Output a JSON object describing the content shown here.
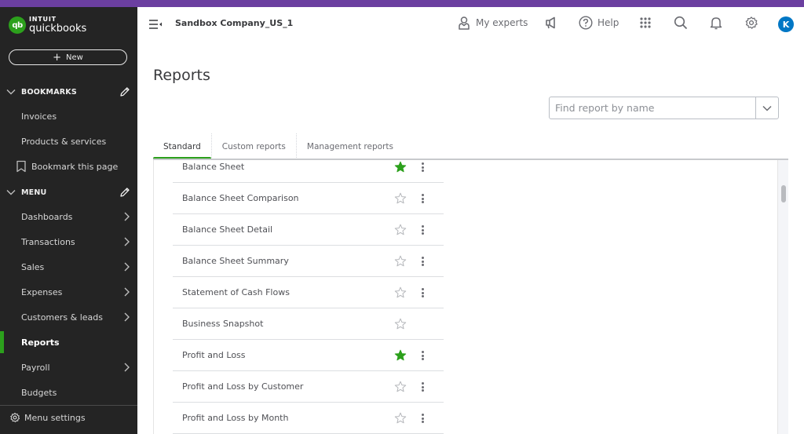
{
  "brand": {
    "badge": "qb",
    "intuit": "INTUIT",
    "product": "quickbooks",
    "accent_top": "#6b3fa0",
    "accent_green": "#2ca01c"
  },
  "sidebar": {
    "new_label": "New",
    "bookmarks_heading": "BOOKMARKS",
    "bookmarks": [
      {
        "label": "Invoices"
      },
      {
        "label": "Products & services"
      }
    ],
    "bookmark_page_label": "Bookmark this page",
    "menu_heading": "MENU",
    "menu": [
      {
        "label": "Dashboards",
        "has_submenu": true
      },
      {
        "label": "Transactions",
        "has_submenu": true
      },
      {
        "label": "Sales",
        "has_submenu": true
      },
      {
        "label": "Expenses",
        "has_submenu": true
      },
      {
        "label": "Customers & leads",
        "has_submenu": true
      },
      {
        "label": "Reports",
        "has_submenu": false,
        "active": true
      },
      {
        "label": "Payroll",
        "has_submenu": true
      },
      {
        "label": "Budgets",
        "has_submenu": false
      }
    ],
    "menu_settings_label": "Menu settings"
  },
  "header": {
    "company_name": "Sandbox Company_US_1",
    "my_experts_label": "My experts",
    "help_label": "Help",
    "avatar_initial": "K"
  },
  "main": {
    "title": "Reports",
    "search": {
      "placeholder": "Find report by name",
      "value": ""
    },
    "tabs": [
      {
        "label": "Standard",
        "active": true
      },
      {
        "label": "Custom reports",
        "active": false
      },
      {
        "label": "Management reports",
        "active": false
      }
    ],
    "reports": [
      {
        "name": "Balance Sheet",
        "favorite": true,
        "has_menu": true
      },
      {
        "name": "Balance Sheet Comparison",
        "favorite": false,
        "has_menu": true
      },
      {
        "name": "Balance Sheet Detail",
        "favorite": false,
        "has_menu": true
      },
      {
        "name": "Balance Sheet Summary",
        "favorite": false,
        "has_menu": true
      },
      {
        "name": "Statement of Cash Flows",
        "favorite": false,
        "has_menu": true
      },
      {
        "name": "Business Snapshot",
        "favorite": false,
        "has_menu": false
      },
      {
        "name": "Profit and Loss",
        "favorite": true,
        "has_menu": true
      },
      {
        "name": "Profit and Loss by Customer",
        "favorite": false,
        "has_menu": true
      },
      {
        "name": "Profit and Loss by Month",
        "favorite": false,
        "has_menu": true
      }
    ]
  }
}
